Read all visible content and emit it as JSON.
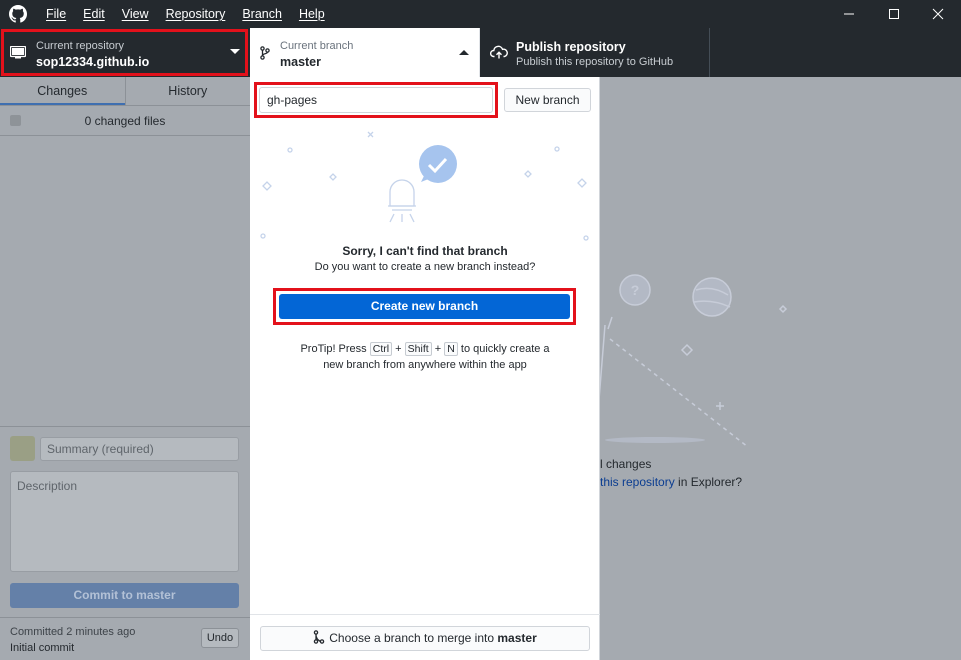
{
  "menu": [
    "File",
    "Edit",
    "View",
    "Repository",
    "Branch",
    "Help"
  ],
  "toolbar": {
    "repo_label": "Current repository",
    "repo_name": "sop12334.github.io",
    "branch_label": "Current branch",
    "branch_name": "master",
    "publish_title": "Publish repository",
    "publish_sub": "Publish this repository to GitHub"
  },
  "left": {
    "tabs": [
      "Changes",
      "History"
    ],
    "changed_files": "0 changed files",
    "summary_placeholder": "Summary (required)",
    "description_placeholder": "Description",
    "commit_prefix": "Commit to ",
    "commit_branch": "master",
    "last_commit_time": "Committed 2 minutes ago",
    "last_commit_msg": "Initial commit",
    "undo": "Undo"
  },
  "dropdown": {
    "filter_value": "gh-pages",
    "new_branch": "New branch",
    "sorry": "Sorry, I can't find that branch",
    "want": "Do you want to create a new branch instead?",
    "create": "Create new branch",
    "protip_1": "ProTip! Press",
    "key_ctrl": "Ctrl",
    "plus": "+",
    "key_shift": "Shift",
    "key_n": "N",
    "protip_2": "to quickly create a",
    "protip_3": "new branch from anywhere within the app",
    "merge_prefix": "Choose a branch to merge into",
    "merge_branch": "master"
  },
  "main": {
    "changes_partial": "l changes",
    "explorer_link": "this repository",
    "explorer_suffix": " in Explorer?"
  },
  "colors": {
    "titlebar": "#24292e",
    "accent_blue": "#0366d6",
    "highlight_red": "#e3111b"
  }
}
